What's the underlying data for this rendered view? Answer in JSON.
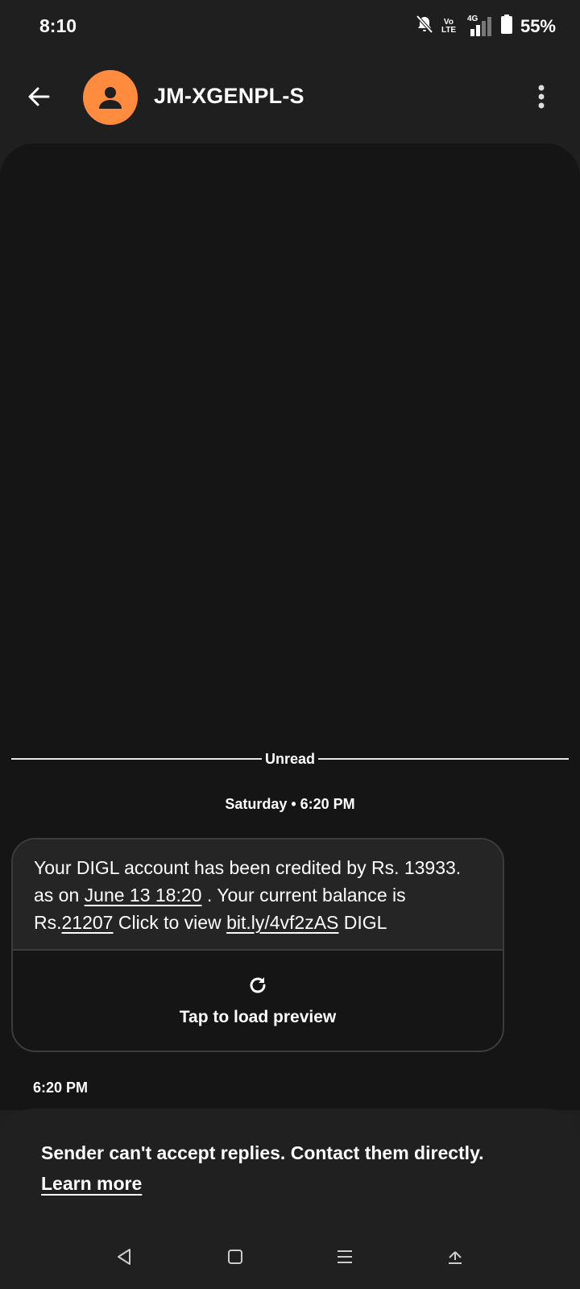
{
  "status_bar": {
    "time": "8:10",
    "network": "4G",
    "volte_top": "Vo",
    "volte_bottom": "LTE",
    "battery": "55%"
  },
  "header": {
    "contact_name": "JM-XGENPL-S",
    "avatar_color": "#ff8b3e"
  },
  "conversation": {
    "divider_label": "Unread",
    "date_label": "Saturday • 6:20 PM",
    "message": {
      "part1": "Your DIGL account has been credited by Rs. 13933. as on ",
      "link_date": "June 13 18:20",
      "part2": " . Your current balance is Rs.",
      "link_balance": "21207",
      "part3": " Click to view ",
      "link_url": "bit.ly/4vf2zAS",
      "part4": " DIGL",
      "preview_label": "Tap to load preview"
    },
    "time": "6:20 PM"
  },
  "notice": {
    "text": "Sender can't accept replies. Contact them directly.",
    "link": "Learn more"
  }
}
